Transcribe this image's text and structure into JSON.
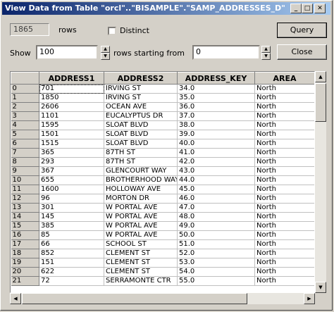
{
  "window": {
    "title": "View Data from Table \"orcl\"..\"BISAMPLE\".\"SAMP_ADDRESSES_D\""
  },
  "rows_count": {
    "value": "1865",
    "label": "rows"
  },
  "distinct": {
    "label": "Distinct",
    "checked": false
  },
  "buttons": {
    "query": "Query",
    "close": "Close"
  },
  "show": {
    "label": "Show",
    "value": "100",
    "starting_label": "rows starting from",
    "start_value": "0"
  },
  "table": {
    "columns": [
      "ADDRESS1",
      "ADDRESS2",
      "ADDRESS_KEY",
      "AREA"
    ],
    "rows": [
      [
        "0",
        "701",
        "IRVING ST",
        "34.0",
        "North"
      ],
      [
        "1",
        "1850",
        "IRVING ST",
        "35.0",
        "North"
      ],
      [
        "2",
        "2606",
        "OCEAN AVE",
        "36.0",
        "North"
      ],
      [
        "3",
        "1101",
        "EUCALYPTUS DR",
        "37.0",
        "North"
      ],
      [
        "4",
        "1595",
        "SLOAT BLVD",
        "38.0",
        "North"
      ],
      [
        "5",
        "1501",
        "SLOAT BLVD",
        "39.0",
        "North"
      ],
      [
        "6",
        "1515",
        "SLOAT BLVD",
        "40.0",
        "North"
      ],
      [
        "7",
        "365",
        "87TH ST",
        "41.0",
        "North"
      ],
      [
        "8",
        "293",
        "87TH ST",
        "42.0",
        "North"
      ],
      [
        "9",
        "367",
        "GLENCOURT WAY",
        "43.0",
        "North"
      ],
      [
        "10",
        "655",
        "BROTHERHOOD WAY",
        "44.0",
        "North"
      ],
      [
        "11",
        "1600",
        "HOLLOWAY AVE",
        "45.0",
        "North"
      ],
      [
        "12",
        "96",
        "MORTON DR",
        "46.0",
        "North"
      ],
      [
        "13",
        "301",
        "W PORTAL AVE",
        "47.0",
        "North"
      ],
      [
        "14",
        "145",
        "W PORTAL AVE",
        "48.0",
        "North"
      ],
      [
        "15",
        "385",
        "W PORTAL AVE",
        "49.0",
        "North"
      ],
      [
        "16",
        "85",
        "W PORTAL AVE",
        "50.0",
        "North"
      ],
      [
        "17",
        "66",
        "SCHOOL ST",
        "51.0",
        "North"
      ],
      [
        "18",
        "852",
        "CLEMENT ST",
        "52.0",
        "North"
      ],
      [
        "19",
        "151",
        "CLEMENT ST",
        "53.0",
        "North"
      ],
      [
        "20",
        "622",
        "CLEMENT ST",
        "54.0",
        "North"
      ],
      [
        "21",
        "72",
        "SERRAMONTE CTR",
        "55.0",
        "North"
      ]
    ]
  }
}
